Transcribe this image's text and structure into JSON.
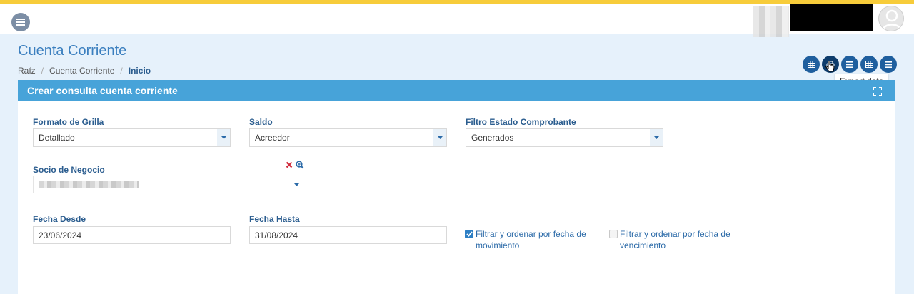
{
  "page": {
    "title": "Cuenta Corriente",
    "breadcrumb": [
      "Raíz",
      "Cuenta Corriente",
      "Inicio"
    ]
  },
  "toolbar": {
    "buttons": [
      {
        "icon": "grid-icon"
      },
      {
        "icon": "export-icon",
        "active": true
      },
      {
        "icon": "list-icon"
      },
      {
        "icon": "grid-icon"
      },
      {
        "icon": "list-icon"
      }
    ],
    "tooltip": "Export data"
  },
  "panel": {
    "title": "Crear consulta cuenta corriente"
  },
  "form": {
    "formato_grilla": {
      "label": "Formato de Grilla",
      "value": "Detallado"
    },
    "saldo": {
      "label": "Saldo",
      "value": "Acreedor"
    },
    "filtro_estado": {
      "label": "Filtro Estado Comprobante",
      "value": "Generados"
    },
    "socio_negocio": {
      "label": "Socio de Negocio"
    },
    "fecha_desde": {
      "label": "Fecha Desde",
      "value": "23/06/2024"
    },
    "fecha_hasta": {
      "label": "Fecha Hasta",
      "value": "31/08/2024"
    },
    "check_movimiento": {
      "line1": "Filtrar y ordenar por fecha de",
      "line2": "movimiento",
      "checked": true
    },
    "check_vencimiento": {
      "line1": "Filtrar y ordenar por fecha de",
      "line2": "vencimiento",
      "checked": false
    }
  },
  "colors": {
    "accent": "#47a3d9",
    "toolbar_button": "#1f5f9e",
    "top_line": "#f7cc3a",
    "title": "#3b7fbf"
  }
}
